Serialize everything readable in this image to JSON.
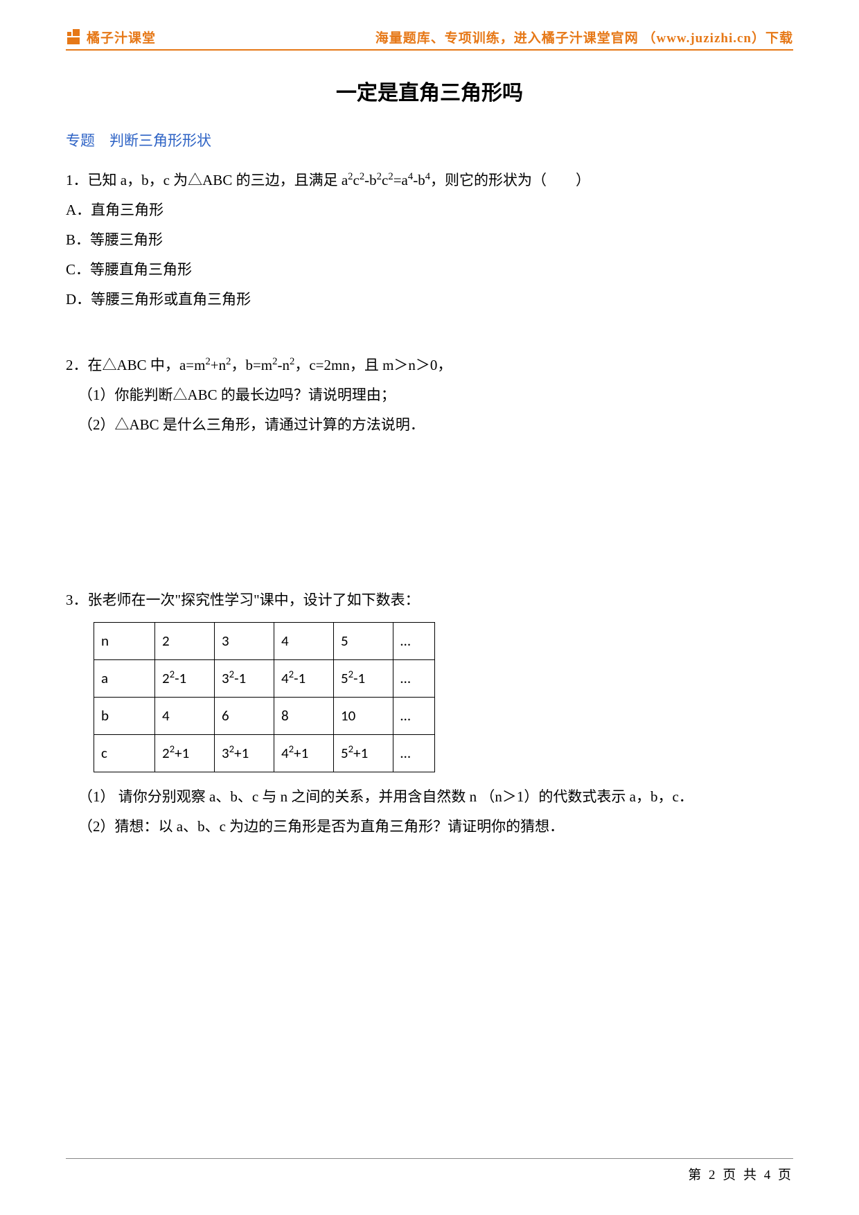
{
  "header": {
    "logo_text": "橘子汁课堂",
    "right_text": "海量题库、专项训练，进入橘子汁课堂官网 （www.juzizhi.cn）下载"
  },
  "title": "一定是直角三角形吗",
  "topic_label": "专题　判断三角形形状",
  "q1": {
    "stem_prefix": "1．已知 a，b，c 为△ABC 的三边，且满足 ",
    "stem_formula_html": "a<sup>2</sup>c<sup>2</sup>-b<sup>2</sup>c<sup>2</sup>=a<sup>4</sup>-b<sup>4</sup>",
    "stem_suffix": "，则它的形状为（　　）",
    "opt_a": "A．直角三角形",
    "opt_b": "B．等腰三角形",
    "opt_c": "C．等腰直角三角形",
    "opt_d": "D．等腰三角形或直角三角形"
  },
  "q2": {
    "line1_prefix": "2．在△ABC 中，",
    "line1_formula_html": "a=m<sup>2</sup>+n<sup>2</sup>，b=m<sup>2</sup>-n<sup>2</sup>，c=2mn，且 m＞n＞0，",
    "sub1": "（1）你能判断△ABC 的最长边吗？请说明理由；",
    "sub2": "（2）△ABC 是什么三角形，请通过计算的方法说明．"
  },
  "q3": {
    "stem": "3．张老师在一次\"探究性学习\"课中，设计了如下数表：",
    "table": {
      "rows": [
        {
          "label": "n",
          "cells_html": [
            "2",
            "3",
            "4",
            "5",
            "…"
          ]
        },
        {
          "label": "a",
          "cells_html": [
            "2<sup>2</sup>-1",
            "3<sup>2</sup>-1",
            "4<sup>2</sup>-1",
            "5<sup>2</sup>-1",
            "…"
          ]
        },
        {
          "label": "b",
          "cells_html": [
            "4",
            "6",
            "8",
            "10",
            "…"
          ]
        },
        {
          "label": "c",
          "cells_html": [
            "2<sup>2</sup>+1",
            "3<sup>2</sup>+1",
            "4<sup>2</sup>+1",
            "5<sup>2</sup>+1",
            "…"
          ]
        }
      ]
    },
    "sub1": "（1） 请你分别观察 a、b、c 与 n 之间的关系，并用含自然数 n （n＞1）的代数式表示 a，b，c．",
    "sub2": "（2）猜想：以 a、b、c 为边的三角形是否为直角三角形？请证明你的猜想．"
  },
  "footer": "第 2 页 共 4 页"
}
